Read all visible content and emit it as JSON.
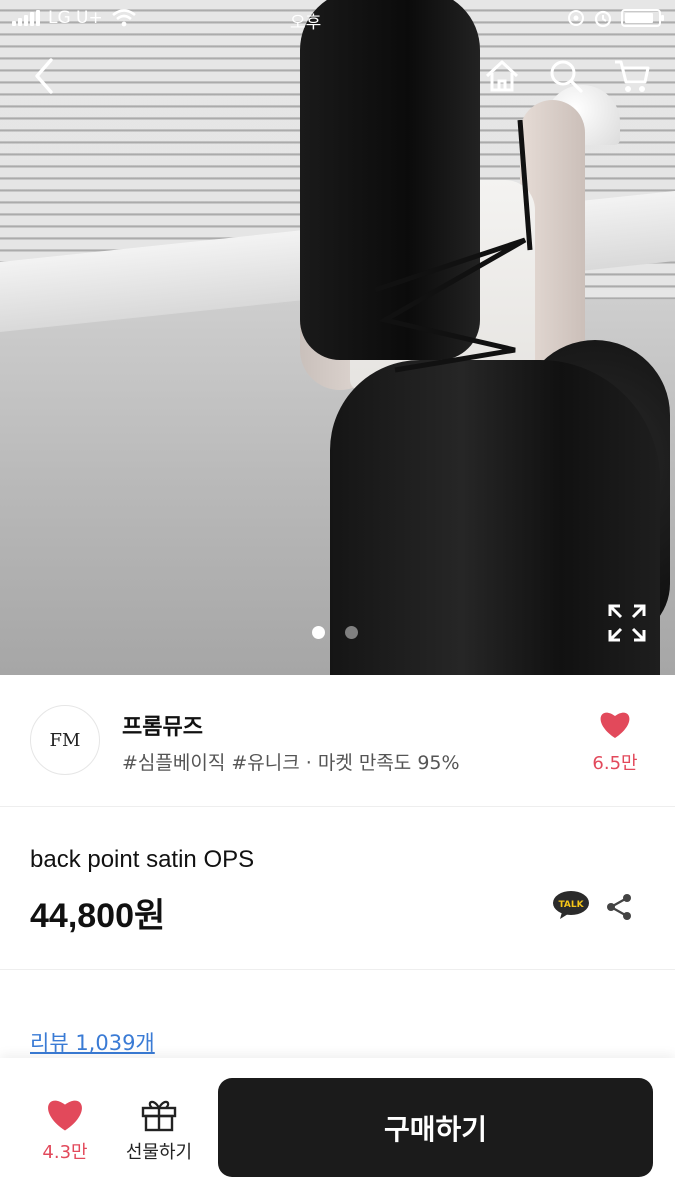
{
  "status_bar": {
    "carrier": "LG U+",
    "time": "오후"
  },
  "shop": {
    "logo_text": "FM",
    "name": "프롬뮤즈",
    "tags": "#심플베이직 #유니크 · 마켓 만족도 95%",
    "like_count": "6.5만"
  },
  "product": {
    "name": "back point satin OPS",
    "price": "44,800원",
    "talk_label": "TALK"
  },
  "review_link": "리뷰 1,039개",
  "bottom_bar": {
    "like_count": "4.3만",
    "gift_label": "선물하기",
    "buy_label": "구매하기"
  },
  "carousel": {
    "total": 2,
    "active_index": 0
  },
  "colors": {
    "accent_red": "#e2495b",
    "buy_button": "#1b1b1b",
    "link_blue": "#3a7bd5"
  }
}
